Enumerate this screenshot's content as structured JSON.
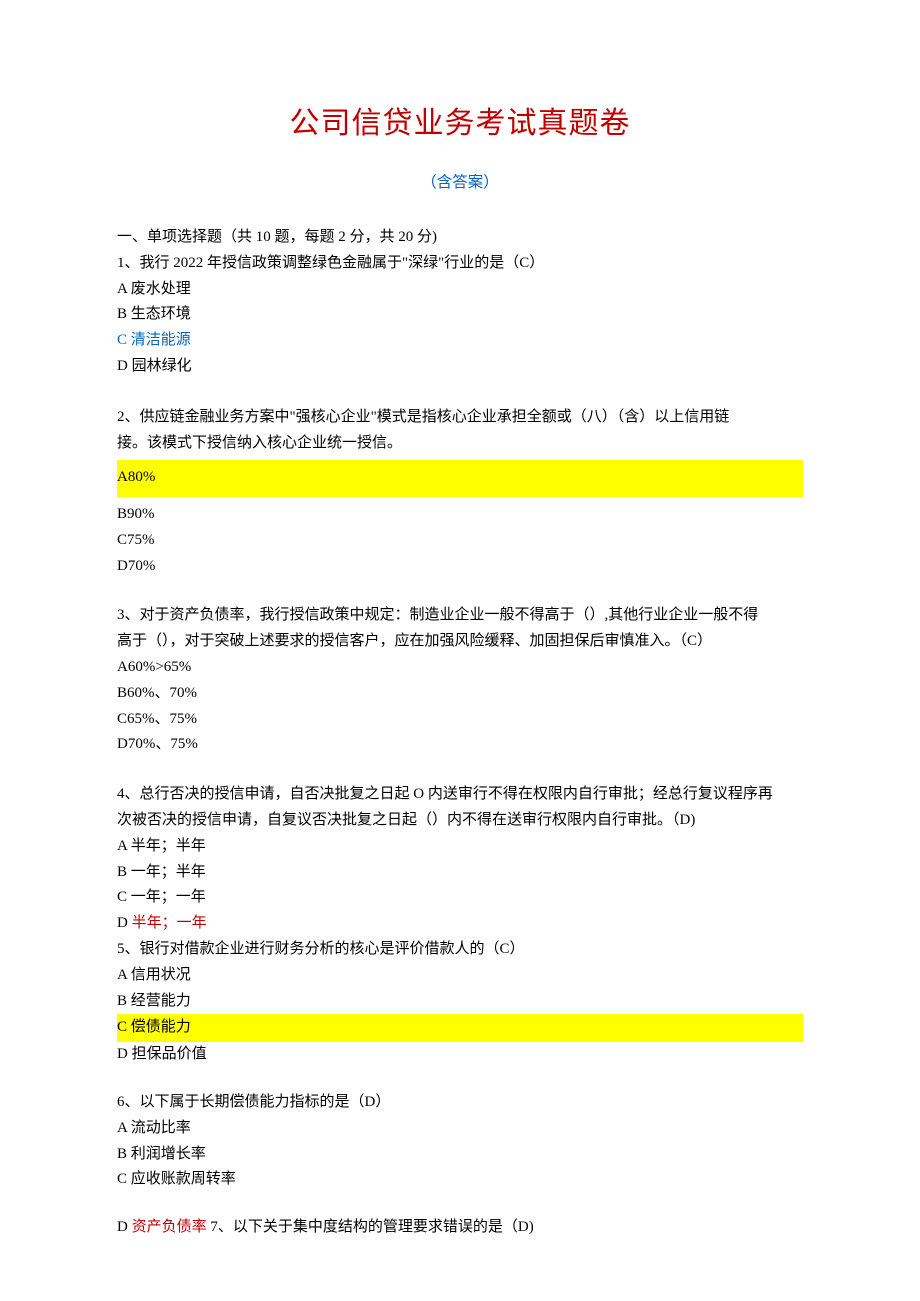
{
  "title": "公司信贷业务考试真题卷",
  "subtitle": "（含答案）",
  "section_header": "一、单项选择题（共 10 题，每题 2 分，共 20 分)",
  "q1": {
    "text": "1、我行 2022 年授信政策调整绿色金融属于\"深绿\"行业的是（C）",
    "a": "A 废水处理",
    "b": "B 生态环境",
    "c": "C 清洁能源",
    "d": "D 园林绿化"
  },
  "q2": {
    "text1": "2、供应链金融业务方案中\"强核心企业\"模式是指核心企业承担全额或（八）（含）以上信用链",
    "text2": "接。该模式下授信纳入核心企业统一授信。",
    "a": "A80%",
    "b": "B90%",
    "c": "C75%",
    "d": "D70%"
  },
  "q3": {
    "text1": "3、对于资产负债率，我行授信政策中规定：制造业企业一般不得高于（）,其他行业企业一般不得",
    "text2": "高于（），对于突破上述要求的授信客户，应在加强风险缓释、加固担保后审慎准入。（C）",
    "a": "A60%>65%",
    "b": "B60%、70%",
    "c": "C65%、75%",
    "d": "D70%、75%"
  },
  "q4": {
    "text1": "4、总行否决的授信申请，自否决批复之日起 O 内送审行不得在权限内自行审批；经总行复议程序再",
    "text2": "次被否决的授信申请，自复议否决批复之日起（）内不得在送审行权限内自行审批。（D)",
    "a": "A 半年；半年",
    "b": "B 一年；半年",
    "c": "C 一年；一年",
    "d_pre": "D ",
    "d_ans": "半年；一年"
  },
  "q5": {
    "text": "5、银行对借款企业进行财务分析的核心是评价借款人的（C）",
    "a": "A 信用状况",
    "b": "B 经营能力",
    "c": "C 偿债能力",
    "d": "D 担保品价值"
  },
  "q6": {
    "text": "6、以下属于长期偿债能力指标的是（D）",
    "a": "A 流动比率",
    "b": "B 利润增长率",
    "c": "C 应收账款周转率"
  },
  "q7": {
    "pre": "D ",
    "ans": "资产负债率",
    "rest": " 7、以下关于集中度结构的管理要求错误的是（D)"
  }
}
